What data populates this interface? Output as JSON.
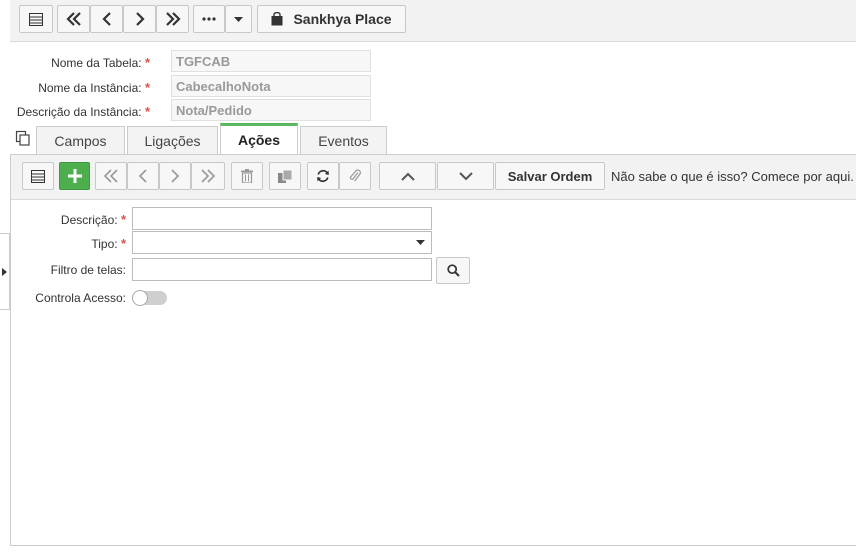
{
  "toolbar": {
    "place_label": "Sankhya Place",
    "icons": [
      "grid-icon",
      "double-chevron-left-icon",
      "chevron-left-icon",
      "chevron-right-icon",
      "double-chevron-right-icon",
      "more-icon",
      "caret-down-icon",
      "bag-icon"
    ]
  },
  "header_form": {
    "table_name_label": "Nome da Tabela:",
    "table_name_value": "TGFCAB",
    "instance_name_label": "Nome da Instância:",
    "instance_name_value": "CabecalhoNota",
    "instance_desc_label": "Descrição da Instância:",
    "instance_desc_value": "Nota/Pedido",
    "required_mark": "*"
  },
  "tabs": [
    {
      "label": "Campos",
      "active": false
    },
    {
      "label": "Ligações",
      "active": false
    },
    {
      "label": "Ações",
      "active": true
    },
    {
      "label": "Eventos",
      "active": false
    }
  ],
  "panel_toolbar": {
    "save_order_label": "Salvar Ordem",
    "hint": "Não sabe o que é isso? Comece por aqui."
  },
  "action_form": {
    "description_label": "Descrição:",
    "description_value": "",
    "type_label": "Tipo:",
    "type_value": "",
    "filter_label": "Filtro de telas:",
    "filter_value": "",
    "access_label": "Controla Acesso:",
    "access_enabled": false
  },
  "colors": {
    "accent_green": "#5cb85c",
    "add_button_green": "#4cae4c",
    "required_red": "#d9534f"
  }
}
